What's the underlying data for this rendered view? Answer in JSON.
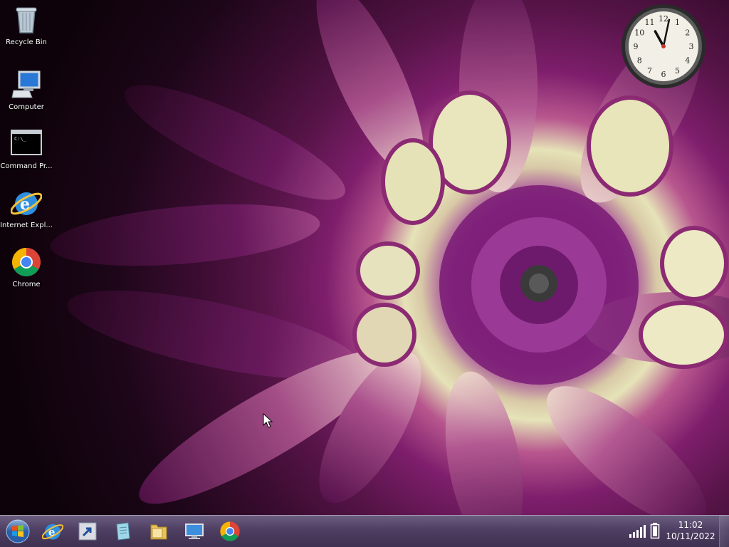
{
  "desktop_icons": [
    {
      "label": "Recycle Bin",
      "icon": "recycle-bin-icon"
    },
    {
      "label": "Computer",
      "icon": "computer-icon"
    },
    {
      "label": "Command Pr...",
      "icon": "command-prompt-icon"
    },
    {
      "label": "Internet Expl...",
      "icon": "internet-explorer-icon"
    },
    {
      "label": "Chrome",
      "icon": "chrome-icon"
    }
  ],
  "clock_gadget": {
    "numerals": [
      "12",
      "1",
      "2",
      "3",
      "4",
      "5",
      "6",
      "7",
      "8",
      "9",
      "10",
      "11"
    ],
    "time_hour": 11,
    "time_minute": 2
  },
  "taskbar": {
    "pinned": [
      {
        "name": "start-orb",
        "icon": "windows-logo-icon"
      },
      {
        "name": "internet-explorer",
        "icon": "internet-explorer-icon"
      },
      {
        "name": "shortcut",
        "icon": "shortcut-arrow-icon"
      },
      {
        "name": "notepad",
        "icon": "document-icon"
      },
      {
        "name": "windows-explorer",
        "icon": "folder-icon"
      },
      {
        "name": "remote-desktop",
        "icon": "monitor-icon"
      },
      {
        "name": "chrome",
        "icon": "chrome-icon"
      }
    ],
    "tray": {
      "time": "11:02",
      "date": "10/11/2022",
      "network_icon": "signal-bars-icon",
      "battery_icon": "battery-icon"
    }
  },
  "colors": {
    "taskbar_top": "#6b5d7e",
    "taskbar_bottom": "#3e3050",
    "flower_center": "#7e1f7c",
    "flower_light": "#e6e3b8"
  }
}
